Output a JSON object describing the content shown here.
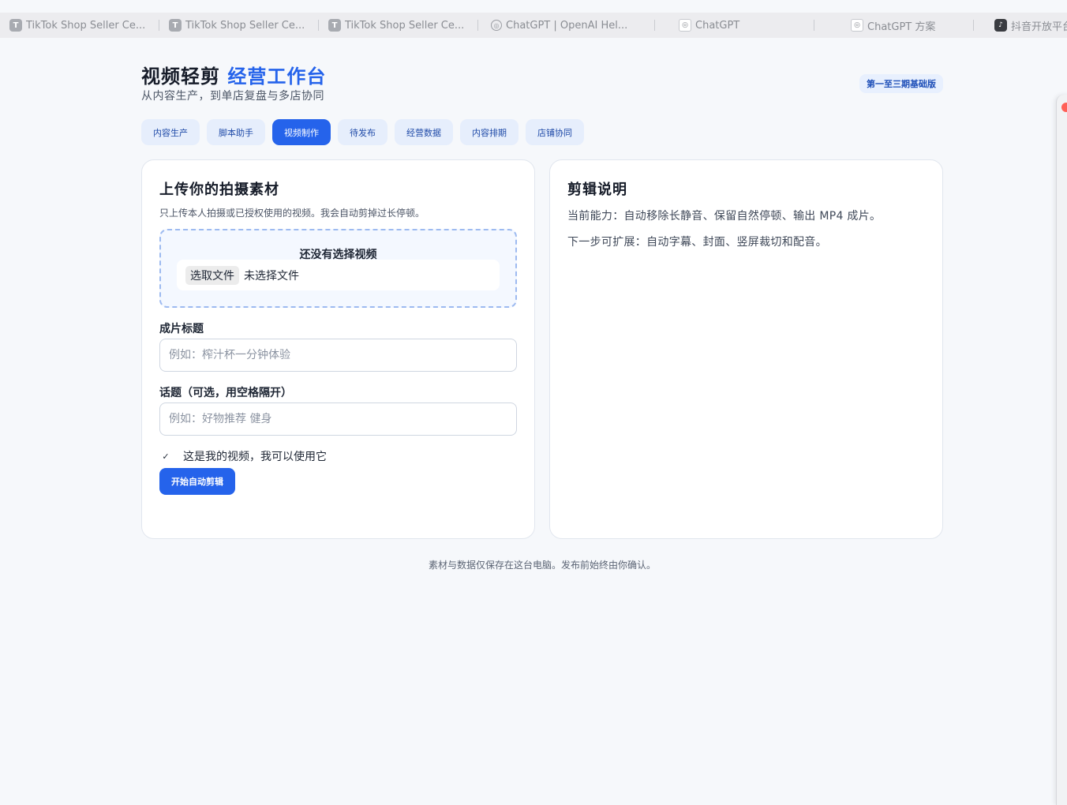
{
  "browser": {
    "tabs": [
      {
        "title": "TikTok Shop Seller Ce...",
        "icon": "tiktok-shop-icon",
        "glyph": "T"
      },
      {
        "title": "TikTok Shop Seller Ce...",
        "icon": "tiktok-shop-icon",
        "glyph": "T"
      },
      {
        "title": "TikTok Shop Seller Ce...",
        "icon": "tiktok-shop-icon",
        "glyph": "T"
      },
      {
        "title": "ChatGPT | OpenAI Hel...",
        "icon": "openai-icon",
        "glyph": "◎"
      },
      {
        "title": "ChatGPT",
        "icon": "openai-icon",
        "glyph": "◎"
      },
      {
        "title": "ChatGPT 方案",
        "icon": "openai-icon",
        "glyph": "◎"
      },
      {
        "title": "抖音开放平台 - 抖音",
        "icon": "douyin-icon",
        "glyph": "♪"
      }
    ]
  },
  "header": {
    "title_main": "视频轻剪",
    "title_accent": "经营工作台",
    "subtitle": "从内容生产，到单店复盘与多店协同",
    "version_badge": "第一至三期基础版"
  },
  "nav": {
    "items": [
      "内容生产",
      "脚本助手",
      "视频制作",
      "待发布",
      "经营数据",
      "内容排期",
      "店铺协同"
    ],
    "active": "视频制作"
  },
  "upload_card": {
    "title": "上传你的拍摄素材",
    "description": "只上传本人拍摄或已授权使用的视频。我会自动剪掉过长停顿。",
    "dropzone_empty": "还没有选择视频",
    "file_button": "选取文件",
    "file_status": "未选择文件",
    "title_label": "成片标题",
    "title_placeholder": "例如：榨汁杯一分钟体验",
    "topic_label": "话题（可选，用空格隔开）",
    "topic_placeholder": "例如：好物推荐 健身",
    "consent_text": "这是我的视频，我可以使用它",
    "consent_checked": true,
    "submit_label": "开始自动剪辑"
  },
  "info_card": {
    "title": "剪辑说明",
    "current": "当前能力：自动移除长静音、保留自然停顿、输出 MP4 成片。",
    "next": "下一步可扩展：自动字幕、封面、竖屏裁切和配音。"
  },
  "footer": {
    "note": "素材与数据仅保存在这台电脑。发布前始终由你确认。"
  },
  "colors": {
    "accent": "#2563eb",
    "background": "#f6f8fb",
    "nav_inactive": "#e6eefc"
  }
}
